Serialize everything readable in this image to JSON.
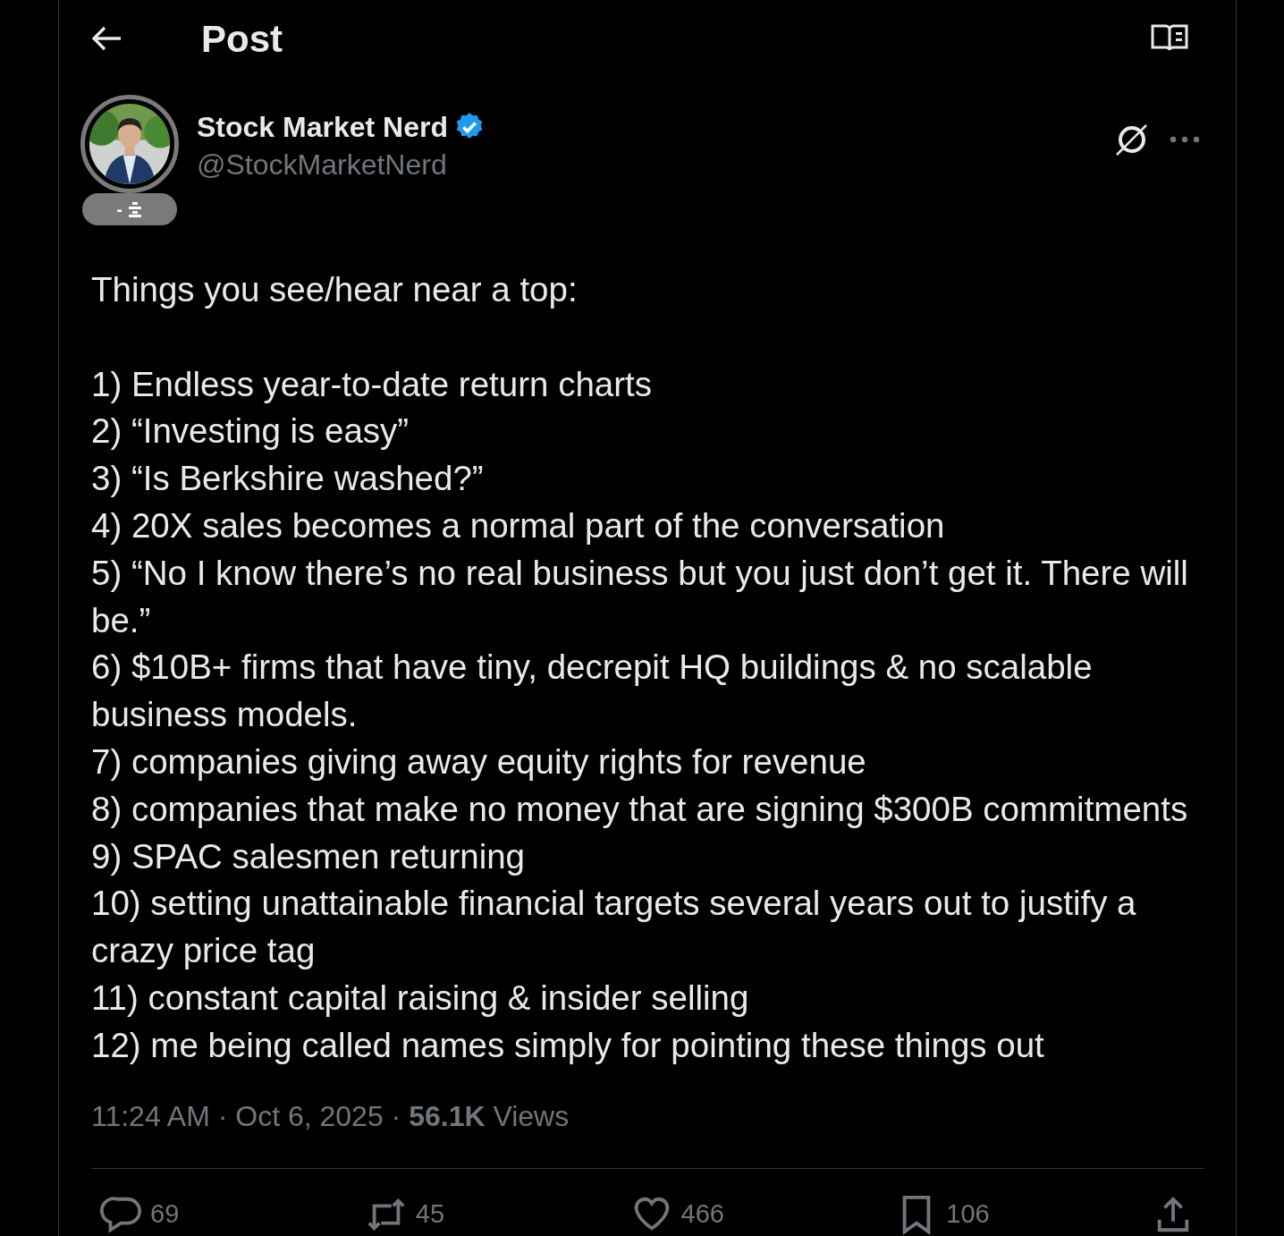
{
  "header": {
    "title": "Post"
  },
  "author": {
    "name": "Stock Market Nerd",
    "handle": "@StockMarketNerd",
    "verified": true,
    "badge": "-"
  },
  "body": {
    "intro": "Things you see/hear near a top:",
    "items": [
      "1) Endless year-to-date return charts",
      "2) “Investing is easy”",
      "3) “Is Berkshire washed?”",
      "4) 20X sales becomes a normal part of the conversation",
      "5) “No I know there’s no real business but you just don’t get it. There will be.”",
      "6) $10B+ firms that have tiny, decrepit HQ buildings & no scalable business models.",
      "7) companies giving away equity rights for revenue",
      "8) companies that make no money that are signing $300B commitments",
      "9) SPAC salesmen returning",
      "10) setting unattainable financial targets several years out to justify a crazy price tag",
      "11) constant capital raising & insider selling",
      "12) me being called names simply for pointing these things out"
    ]
  },
  "meta": {
    "line": "11:24 AM · Oct 6, 2025 · **56.1K** Views"
  },
  "actions": [
    {
      "kind": "reply",
      "count": "69"
    },
    {
      "kind": "repost",
      "count": "45"
    },
    {
      "kind": "like",
      "count": "466"
    },
    {
      "kind": "bookmark",
      "count": "106"
    },
    {
      "kind": "share"
    }
  ]
}
